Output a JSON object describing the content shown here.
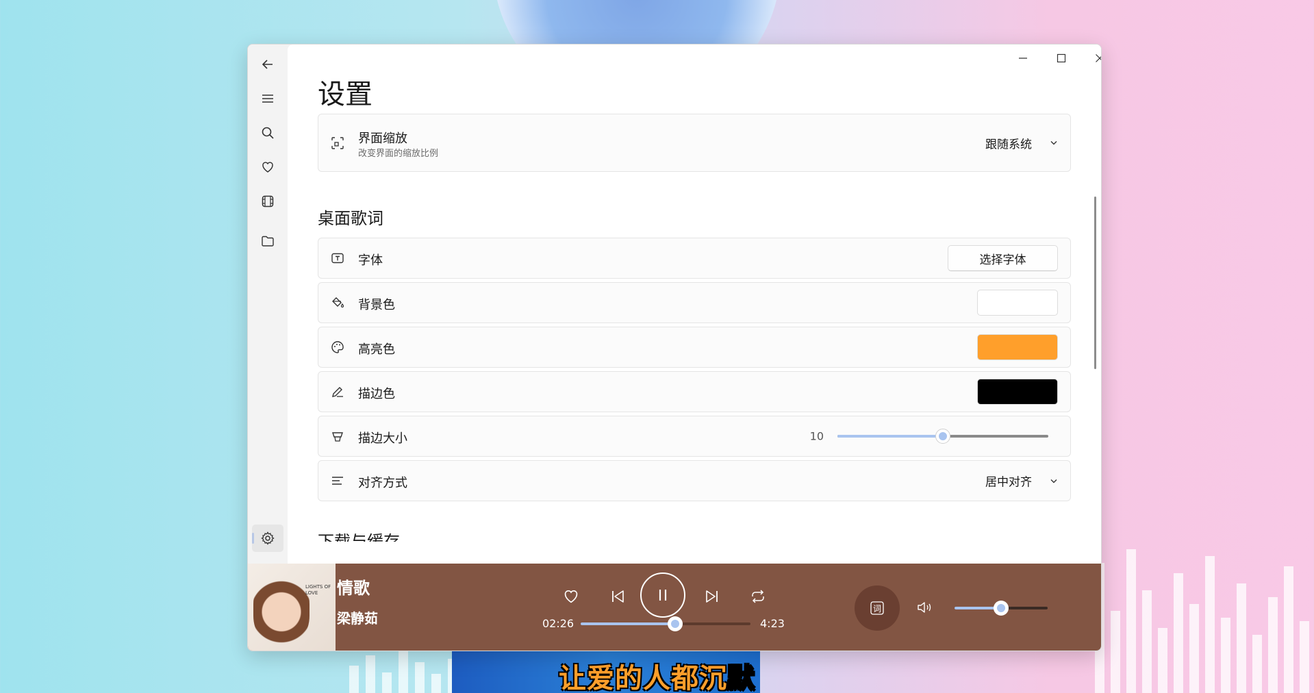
{
  "window": {
    "minimize_icon": "minimize-icon",
    "maximize_icon": "maximize-icon",
    "close_icon": "close-icon"
  },
  "nav": {
    "items": [
      {
        "name": "back",
        "icon": "arrow-left-icon"
      },
      {
        "name": "menu",
        "icon": "hamburger-icon"
      },
      {
        "name": "search",
        "icon": "search-icon"
      },
      {
        "name": "favorites",
        "icon": "heart-icon"
      },
      {
        "name": "video",
        "icon": "film-icon"
      },
      {
        "name": "folder",
        "icon": "folder-icon"
      }
    ],
    "settings_icon": "gear-icon"
  },
  "page": {
    "title": "设置",
    "scale": {
      "label": "界面缩放",
      "description": "改变界面的缩放比例",
      "value": "跟随系统"
    },
    "desktop_lyric": {
      "section_title": "桌面歌词",
      "font": {
        "label": "字体",
        "button": "选择字体"
      },
      "background": {
        "label": "背景色",
        "color": "#ffffff"
      },
      "highlight": {
        "label": "高亮色",
        "color": "#ff9f2b"
      },
      "stroke": {
        "label": "描边色",
        "color": "#000000"
      },
      "stroke_size": {
        "label": "描边大小",
        "value": "10",
        "fraction": 0.5
      },
      "alignment": {
        "label": "对齐方式",
        "value": "居中对齐"
      }
    },
    "next_section_title": "下载与缓存"
  },
  "player": {
    "song_title": "情歌",
    "artist": "梁静茹",
    "current_time": "02:26",
    "total_time": "4:23",
    "progress_fraction": 0.555,
    "volume_fraction": 0.5,
    "lyric_button_label": "词",
    "accent": "#825543"
  },
  "desktop_lyric_overlay": {
    "highlighted": "让爱的人都沉",
    "rest": "默"
  },
  "cover_text": "LIGHTS OF LOVE"
}
